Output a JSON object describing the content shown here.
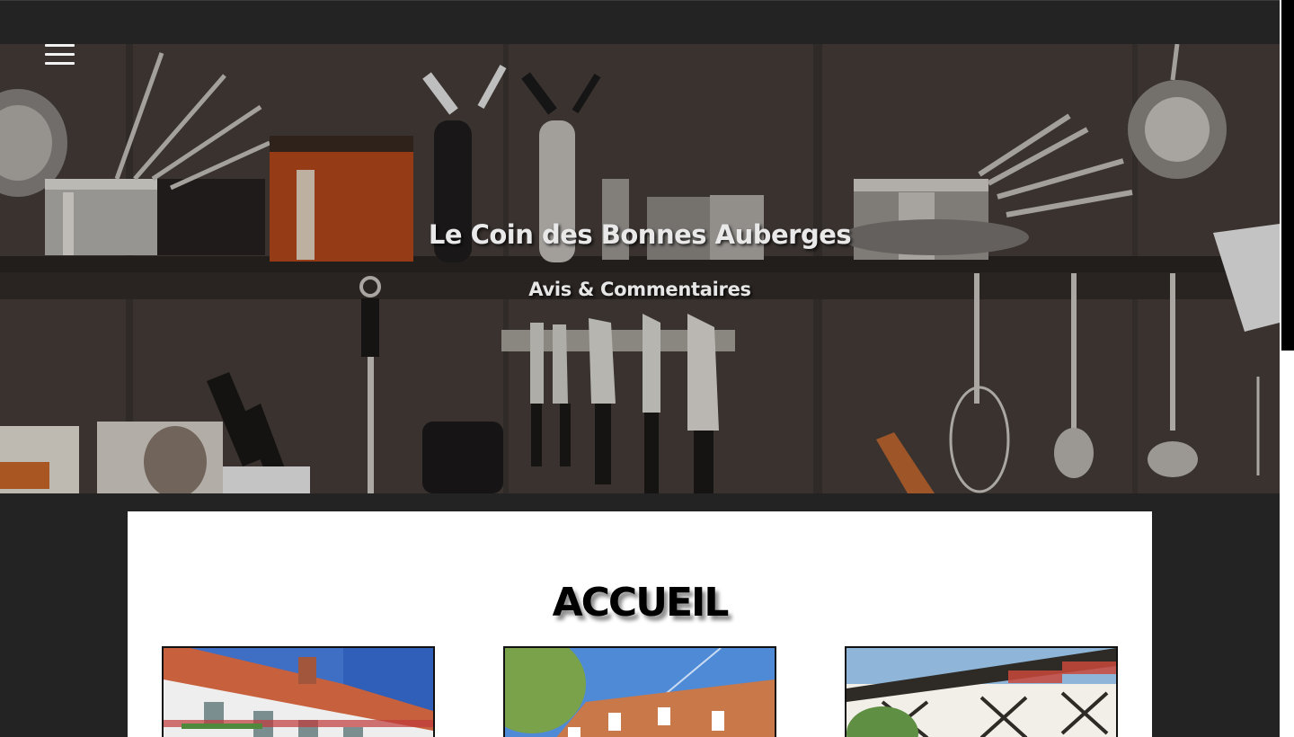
{
  "site": {
    "title": "Le Coin des Bonnes Auberges",
    "subtitle": "Avis & Commentaires"
  },
  "navigation": {
    "menu_icon": "hamburger-menu-icon"
  },
  "main": {
    "heading": "ACCUEIL",
    "cards": [
      {
        "image": "inn-white-facade-photo"
      },
      {
        "image": "inn-brick-roof-photo"
      },
      {
        "image": "inn-half-timbered-photo"
      }
    ]
  },
  "colors": {
    "page_background": "#232323",
    "content_background": "#ffffff",
    "title_text": "#e9e9e9",
    "heading_text": "#000000"
  }
}
